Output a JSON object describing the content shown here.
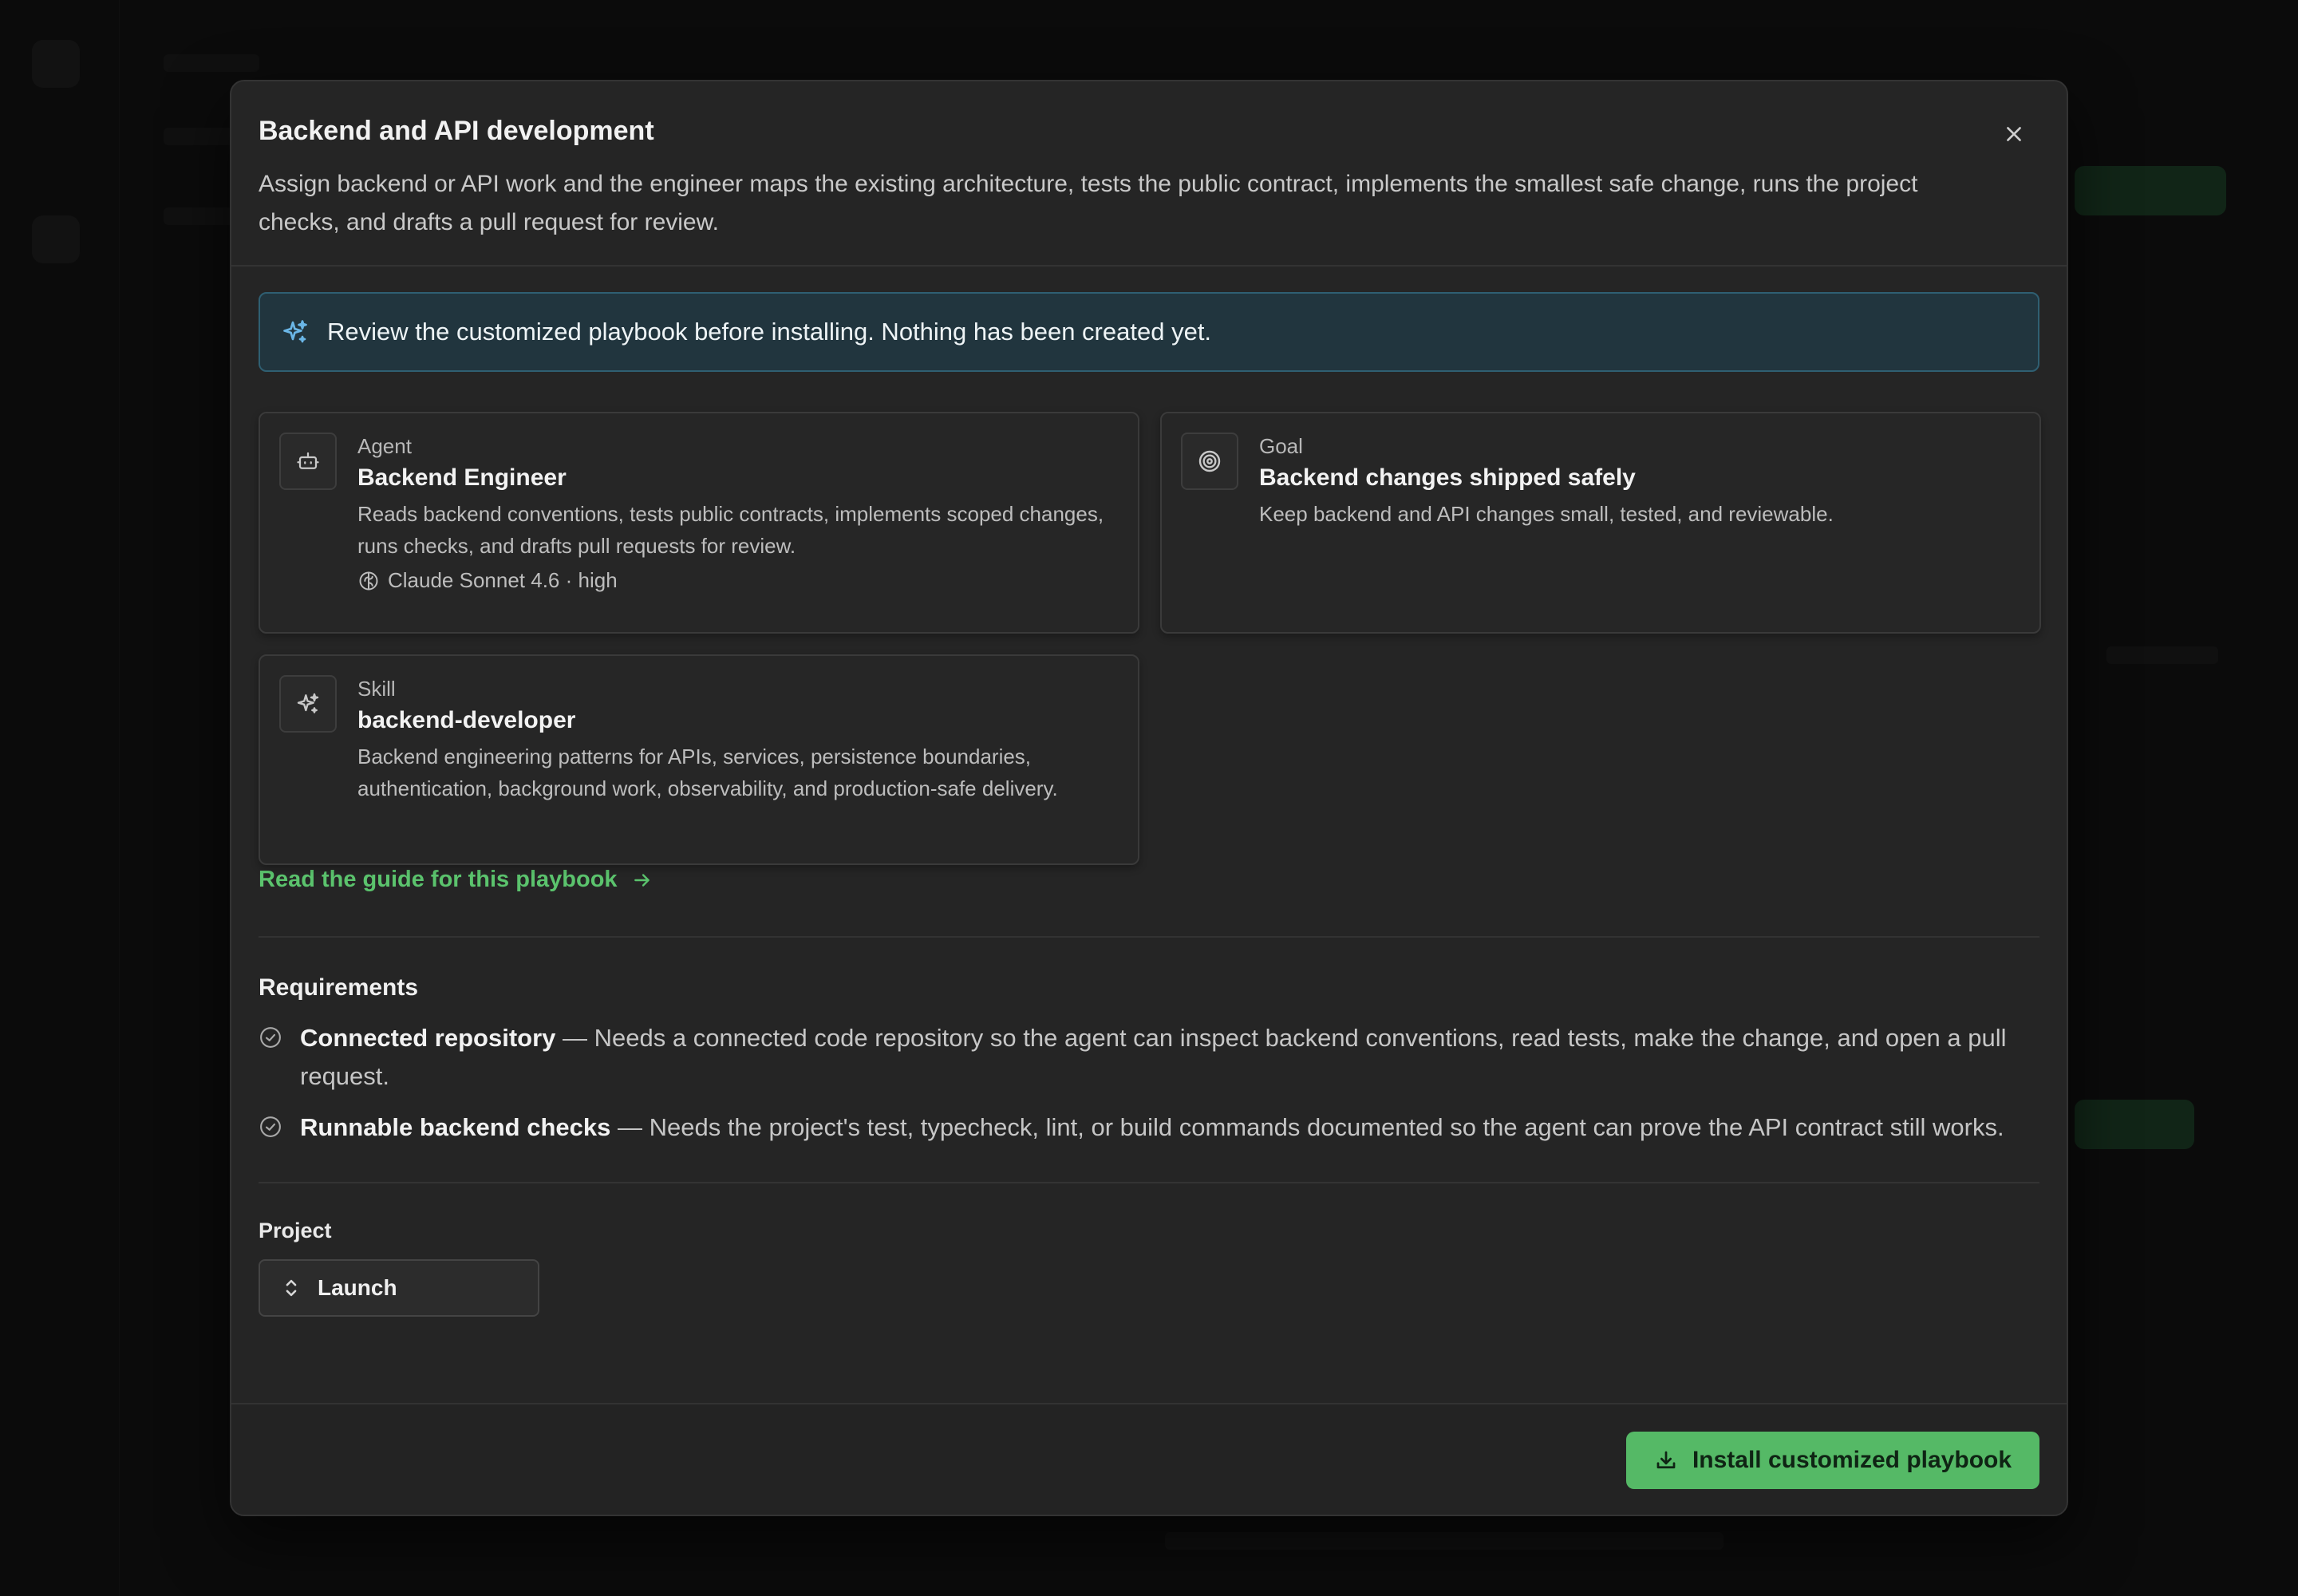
{
  "modal": {
    "title": "Backend and API development",
    "description": "Assign backend or API work and the engineer maps the existing architecture, tests the public contract, implements the smallest safe change, runs the project checks, and drafts a pull request for review."
  },
  "banner": {
    "text": "Review the customized playbook before installing. Nothing has been created yet.",
    "icon": "sparkles-icon",
    "color": "#21353e"
  },
  "cards": {
    "agent": {
      "kind": "Agent",
      "title": "Backend Engineer",
      "description": "Reads backend conventions, tests public contracts, implements scoped changes, runs checks, and drafts pull requests for review.",
      "model": "Claude Sonnet 4.6 · high",
      "icon": "bot-icon"
    },
    "goal": {
      "kind": "Goal",
      "title": "Backend changes shipped safely",
      "description": "Keep backend and API changes small, tested, and reviewable.",
      "icon": "target-icon"
    },
    "skill": {
      "kind": "Skill",
      "title": "backend-developer",
      "description": "Backend engineering patterns for APIs, services, persistence boundaries, authentication, background work, observability, and production-safe delivery.",
      "icon": "sparkles-icon"
    }
  },
  "guide_link": "Read the guide for this playbook",
  "requirements": {
    "title": "Requirements",
    "items": [
      {
        "name": "Connected repository",
        "text": " — Needs a connected code repository so the agent can inspect backend conventions, read tests, make the change, and open a pull request."
      },
      {
        "name": "Runnable backend checks",
        "text": " — Needs the project's test, typecheck, lint, or build commands documented so the agent can prove the API contract still works."
      }
    ]
  },
  "project": {
    "label": "Project",
    "selected": "Launch"
  },
  "install_button": "Install customized playbook",
  "colors": {
    "accent": "#55b966",
    "link": "#5bc36d",
    "banner_border": "#2f5f72"
  }
}
